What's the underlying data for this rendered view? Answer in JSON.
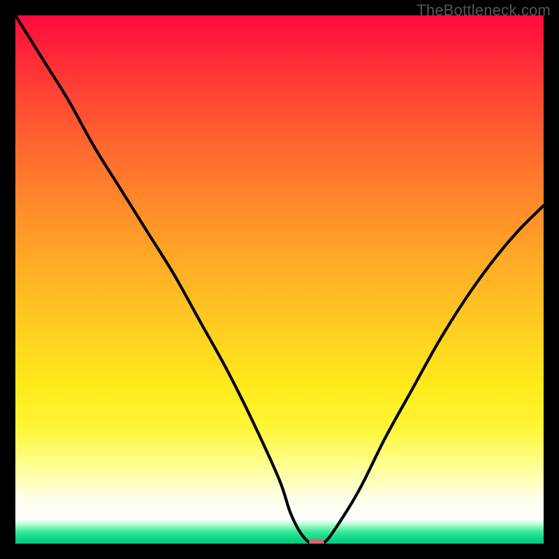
{
  "watermark": "TheBottleneck.com",
  "colors": {
    "frame": "#000000",
    "curve": "#000000",
    "marker": "#d36a6a",
    "watermark_text": "#555559"
  },
  "chart_data": {
    "type": "line",
    "title": "",
    "xlabel": "",
    "ylabel": "",
    "xlim": [
      0,
      100
    ],
    "ylim": [
      0,
      100
    ],
    "grid": false,
    "legend": false,
    "background_gradient": {
      "top_color": "#ff0b3f",
      "mid_color": "#ffd820",
      "low_color": "#ffffff",
      "bottom_color": "#02cb80"
    },
    "series": [
      {
        "name": "bottleneck-curve",
        "x": [
          0,
          5,
          10,
          15,
          20,
          25,
          30,
          35,
          40,
          45,
          50,
          52,
          54,
          56,
          58,
          60,
          65,
          70,
          75,
          80,
          85,
          90,
          95,
          100
        ],
        "y": [
          100,
          92,
          84,
          75,
          67,
          59,
          51,
          42,
          33,
          23,
          12,
          6,
          2,
          0,
          0,
          2,
          10,
          20,
          29,
          38,
          46,
          53,
          59,
          64
        ]
      }
    ],
    "marker": {
      "x": 57,
      "y": 0
    }
  }
}
